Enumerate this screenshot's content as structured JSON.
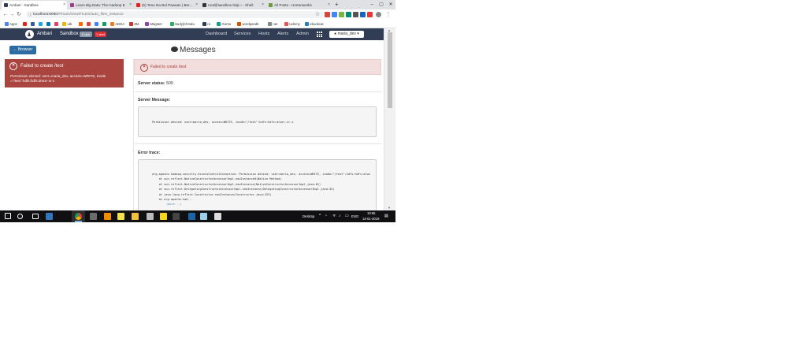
{
  "browser": {
    "tabs": [
      {
        "title": "Ambari - Sandbox",
        "active": true,
        "fav_color": "#313d54"
      },
      {
        "title": "Learn Big Data: The Hadoop E",
        "active": false,
        "fav_color": "#a03a8a"
      },
      {
        "title": "(5) Tenu Na Bol Pawaan | Ber...",
        "active": false,
        "fav_color": "#e62117"
      },
      {
        "title": "root@sandbox-hdp:~ - Shell",
        "active": false,
        "fav_color": "#333333"
      },
      {
        "title": "All Posts - Hortonworks",
        "active": false,
        "fav_color": "#6a9a3b"
      }
    ],
    "new_tab": "+",
    "window_buttons": [
      "–",
      "▢",
      "✕"
    ],
    "address": {
      "host": "localhost:8080",
      "path": "/#/main/view/FILES/auto_files_instance"
    },
    "bookmarks": [
      {
        "label": "Apps",
        "color": "#4f86ec"
      },
      {
        "label": "",
        "color": "#e62117"
      },
      {
        "label": "",
        "color": "#3b5998"
      },
      {
        "label": "",
        "color": "#1da1f2"
      },
      {
        "label": "",
        "color": "#0077b5"
      },
      {
        "label": "",
        "color": "#e4405f"
      },
      {
        "label": "utk",
        "color": "#f4b400"
      },
      {
        "label": "",
        "color": "#ff6600"
      },
      {
        "label": "",
        "color": "#db4437"
      },
      {
        "label": "",
        "color": "#4285f4"
      },
      {
        "label": "",
        "color": "#0f9d58"
      },
      {
        "label": "ADDA",
        "color": "#e67e22"
      },
      {
        "label": "JIM",
        "color": "#c0392b"
      },
      {
        "label": "Magster",
        "color": "#8e44ad"
      },
      {
        "label": "study|Chmdu",
        "color": "#27ae60"
      },
      {
        "label": "ra",
        "color": "#2c3e50"
      },
      {
        "label": "Gonto",
        "color": "#16a085"
      },
      {
        "label": "wordpandit",
        "color": "#d35400"
      },
      {
        "label": "net",
        "color": "#7f8c8d"
      },
      {
        "label": "Udemy",
        "color": "#ec5252"
      },
      {
        "label": "ebookcat",
        "color": "#2980b9"
      }
    ]
  },
  "ambari": {
    "brand": "Ambari",
    "cluster": "Sandbox",
    "ops_badge": "0 ops",
    "alert_badge": "1 alert",
    "menu": [
      "Dashboard",
      "Services",
      "Hosts",
      "Alerts",
      "Admin"
    ],
    "user": "maria_dev ▾"
  },
  "files_view": {
    "browser_button": "← Browser",
    "title": "Messages",
    "left_alert": {
      "title": "Failed to create /test",
      "detail": "Permission denied: user=maria_dev, access=WRITE, inode =\"/test\":hdfs:hdfs:drwxr-xr-x"
    },
    "message": {
      "banner": "Failed to create /test",
      "server_status_label": "Server status:",
      "server_status_value": "500",
      "server_message_label": "Server Message:",
      "server_message": "Permission denied: user=maria_dev, access=WRITE, inode=\"/test\":hdfs:hdfs:drwxr-xr-x",
      "error_trace_label": "Error trace:",
      "trace_lines": [
        "org.apache.hadoop.security.AccessControlException: Permission denied: user=maria_dev, access=WRITE, inode=\"/test\":hdfs:hdfs:drwx",
        "    at sun.reflect.NativeConstructorAccessorImpl.newInstance0(Native Method)",
        "    at sun.reflect.NativeConstructorAccessorImpl.newInstance(NativeConstructorAccessorImpl.java:62)",
        "    at sun.reflect.DelegatingConstructorAccessorImpl.newInstance(DelegatingConstructorAccessorImpl.java:45)",
        "    at java.lang.reflect.Constructor.newInstance(Constructor.java:423)",
        "    at org.apache.had..."
      ],
      "more": "(more...)"
    }
  },
  "taskbar": {
    "desktop_label": "Desktop",
    "lang": "ENG",
    "time": "19:55",
    "date": "14-01-2019",
    "apps": [
      {
        "name": "start",
        "color": "#ffffff"
      },
      {
        "name": "search",
        "color": "#ffffff"
      },
      {
        "name": "task-view",
        "color": "#ffffff"
      },
      {
        "name": "edge",
        "color": "#3277bc"
      },
      {
        "name": "chrome",
        "color": "#f4b400"
      },
      {
        "name": "calculator",
        "color": "#6b6b6b"
      },
      {
        "name": "vlc",
        "color": "#f08c00"
      },
      {
        "name": "sticky",
        "color": "#f5e04e"
      },
      {
        "name": "explorer",
        "color": "#f3c03e"
      },
      {
        "name": "monitor",
        "color": "#bbbbbb"
      },
      {
        "name": "sticky-notes",
        "color": "#f7d51d"
      },
      {
        "name": "tool",
        "color": "#444444"
      },
      {
        "name": "virtualbox",
        "color": "#1b65a6"
      },
      {
        "name": "app",
        "color": "#9ad0ea"
      },
      {
        "name": "app2",
        "color": "#dddddd"
      }
    ]
  }
}
